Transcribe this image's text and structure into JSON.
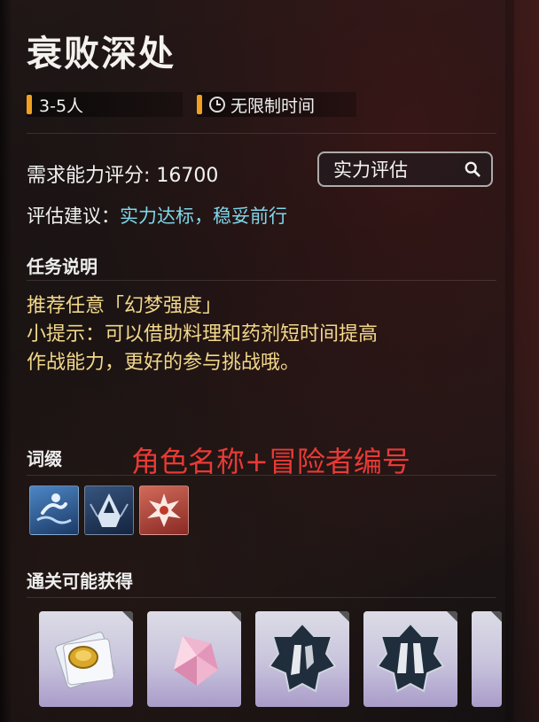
{
  "dungeon": {
    "title": "衰败深处",
    "players": "3-5人",
    "time_limit": "无限制时间"
  },
  "power": {
    "requirement": "需求能力评分: 16700",
    "assess_button": "实力评估",
    "advice_label": "评估建议：",
    "advice_value": "实力达标，稳妥前行"
  },
  "mission": {
    "heading": "任务说明",
    "lines": [
      "推荐任意「幻梦强度」",
      "小提示：可以借助料理和药剂短时间提高",
      "作战能力，更好的参与挑战哦。"
    ]
  },
  "affix": {
    "heading": "词缀",
    "overlay_text": "角色名称+冒险者编号",
    "icons": [
      "swimmer-affix-icon",
      "hooded-figure-affix-icon",
      "explosion-affix-icon"
    ]
  },
  "rewards": {
    "heading": "通关可能获得",
    "items": [
      "coin-scroll-icon",
      "pink-crystal-icon",
      "armor-legs-icon",
      "armor-leggings-icon",
      "partial-reward-icon"
    ]
  },
  "colors": {
    "accent_orange": "#f0a020",
    "advice_blue": "#7fd6ea",
    "description_gold": "#f2d88a",
    "overlay_red": "#e83a36"
  }
}
